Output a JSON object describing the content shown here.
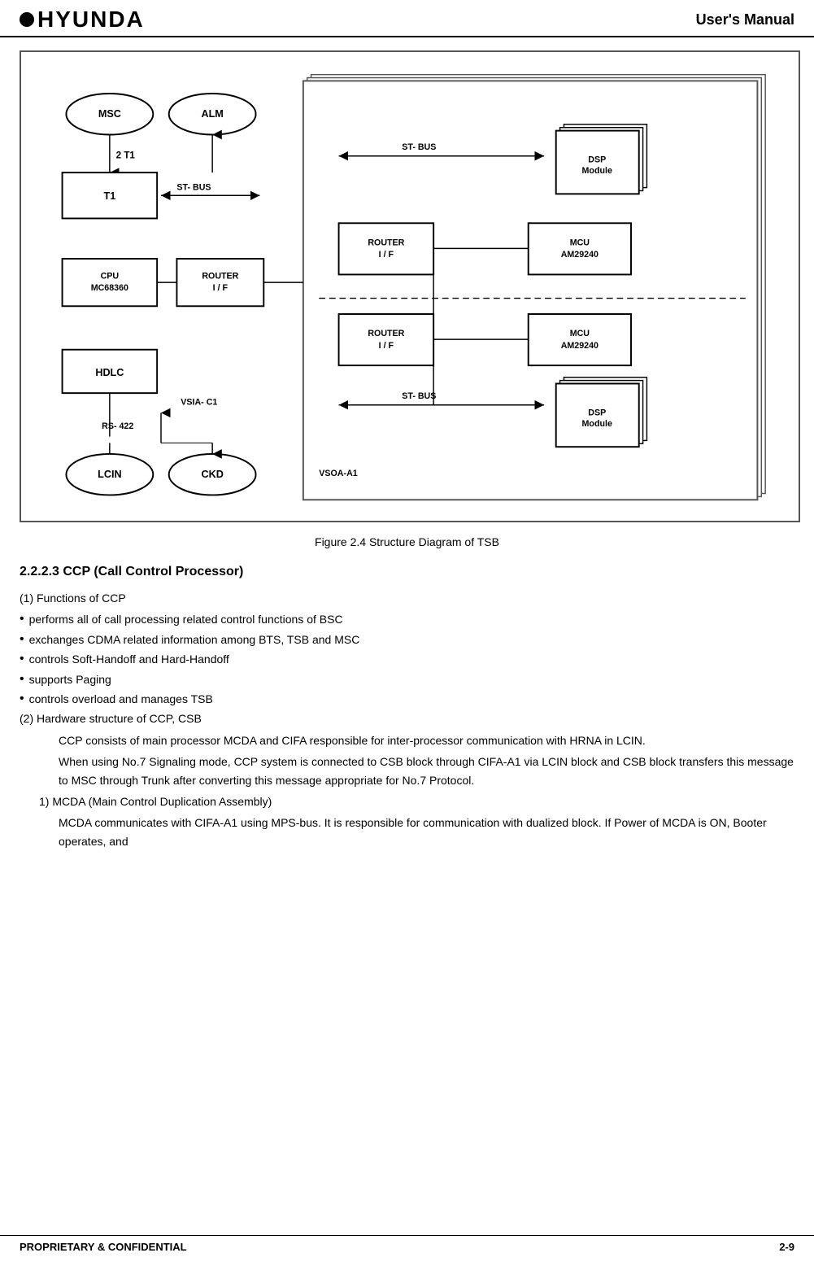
{
  "header": {
    "logo_text": "HYUNDA",
    "title": "User's Manual"
  },
  "diagram": {
    "figure_caption": "Figure 2.4 Structure Diagram of TSB",
    "labels": {
      "msc": "MSC",
      "alm": "ALM",
      "t1": "T1",
      "cpu": "CPU\nMC68360",
      "router_if_left": "ROUTER\nI / F",
      "hdlc": "HDLC",
      "lcin": "LCIN",
      "ckd": "CKD",
      "st_bus_top": "ST- BUS",
      "st_bus_bottom": "ST- BUS",
      "router_if_top": "ROUTER\nI / F",
      "mcu_top": "MCU\nAM29240",
      "router_if_bottom": "ROUTER\nI / F",
      "mcu_bottom": "MCU\nAM29240",
      "dsp_top": "DSP\nModule",
      "dsp_bottom": "DSP\nModule",
      "vsoa_a1": "VSOA-A1",
      "vsia_c1": "VSIA-C1",
      "rs422": "RS- 422",
      "two_t1": "2  T1",
      "st_bus_left": "ST- BUS"
    }
  },
  "section": {
    "heading": "2.2.2.3  CCP (Call Control Processor)",
    "functions_title": "(1) Functions of CCP",
    "bullets": [
      "performs all of call processing related control functions of BSC",
      "exchanges CDMA related information among BTS, TSB and MSC",
      "controls Soft-Handoff and Hard-Handoff",
      "supports Paging",
      "controls overload and manages TSB"
    ],
    "hardware_title": "(2) Hardware structure of CCP, CSB",
    "hardware_para1": "CCP consists of main processor MCDA and CIFA responsible for inter-processor communication with HRNA in LCIN.",
    "hardware_para2": "When using No.7 Signaling mode, CCP system is connected to CSB block through CIFA-A1 via LCIN block and CSB block transfers this message to MSC through Trunk after converting this message appropriate for No.7 Protocol.",
    "mcda_heading": "1) MCDA (Main Control Duplication Assembly)",
    "mcda_para": "MCDA communicates with CIFA-A1 using MPS-bus. It is responsible for communication with dualized block. If Power of MCDA is ON, Booter operates, and"
  },
  "footer": {
    "left": "PROPRIETARY & CONFIDENTIAL",
    "right": "2-9"
  }
}
